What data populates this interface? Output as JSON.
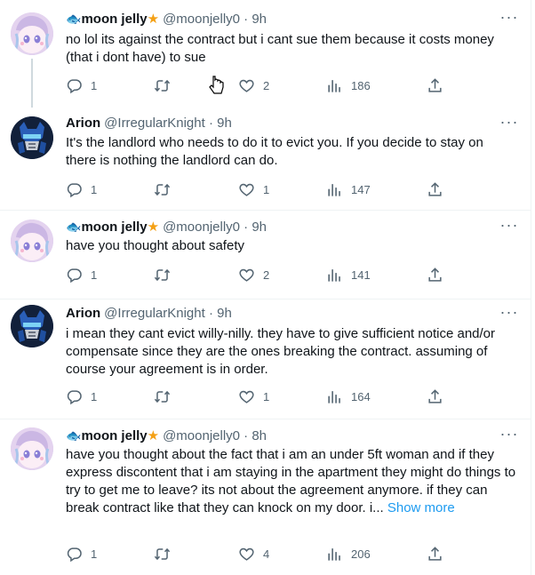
{
  "tweets": [
    {
      "name": "moon jelly",
      "handle": "@moonjelly0 · 9h",
      "text": "no lol its against the contract but i cant sue them because it costs money (that i dont have) to sue",
      "replies": "1",
      "likes": "2",
      "views": "186"
    },
    {
      "name": "Arion",
      "handle": "@IrregularKnight · 9h",
      "text": "It's the landlord who needs to do it to evict you. If you decide to stay on there is nothing the landlord can do.",
      "replies": "1",
      "likes": "1",
      "views": "147"
    },
    {
      "name": "moon jelly",
      "handle": "@moonjelly0 · 9h",
      "text": "have you thought about safety",
      "replies": "1",
      "likes": "2",
      "views": "141"
    },
    {
      "name": "Arion",
      "handle": "@IrregularKnight · 9h",
      "text": "i mean they cant evict willy-nilly. they have to give sufficient notice and/or compensate since they are the ones breaking the contract. assuming of course your agreement is in order.",
      "replies": "1",
      "likes": "1",
      "views": "164"
    },
    {
      "name": "moon jelly",
      "handle": "@moonjelly0 · 8h",
      "text": "have you thought about the fact that i am an under 5ft woman and if they express discontent that i am staying in the apartment they might do things to try to get me to leave? its not about the  agreement anymore. if they can break contract like that they can knock on my door. i...",
      "show_more": "Show more",
      "replies": "1",
      "likes": "4",
      "views": "206"
    }
  ],
  "icons": {
    "reply": "reply-icon",
    "retweet": "retweet-icon",
    "like": "heart-icon",
    "views": "views-icon",
    "share": "share-icon",
    "more": "more-icon"
  },
  "colors": {
    "accent": "#1d9bf0",
    "text": "#0f1419",
    "muted": "#536471",
    "divider": "#eff3f4",
    "star": "#f4a014"
  }
}
